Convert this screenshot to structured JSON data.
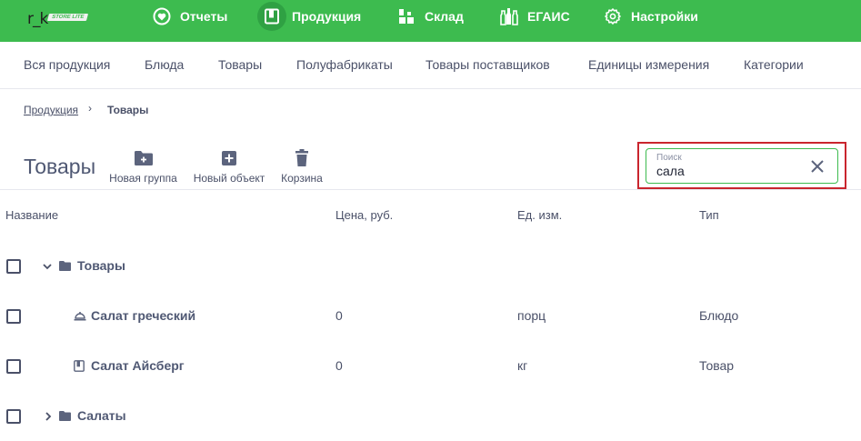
{
  "logo": {
    "text": "r_k",
    "tag": "STORE LITE"
  },
  "topnav": {
    "items": [
      {
        "label": "Отчеты",
        "icon": "heart-circle-icon"
      },
      {
        "label": "Продукция",
        "icon": "book-icon",
        "active": true
      },
      {
        "label": "Склад",
        "icon": "boxes-icon"
      },
      {
        "label": "ЕГАИС",
        "icon": "bottles-icon"
      },
      {
        "label": "Настройки",
        "icon": "gear-icon"
      }
    ]
  },
  "subnav": {
    "items": [
      "Вся продукция",
      "Блюда",
      "Товары",
      "Полуфабрикаты",
      "Товары поставщиков",
      "Единицы измерения",
      "Категории"
    ]
  },
  "breadcrumb": {
    "parent": "Продукция",
    "separator": "›",
    "current": "Товары"
  },
  "page": {
    "title": "Товары"
  },
  "toolbar": {
    "new_group": "Новая группа",
    "new_object": "Новый объект",
    "trash": "Корзина"
  },
  "search": {
    "placeholder": "Поиск",
    "value": "сала"
  },
  "table": {
    "columns": [
      "Название",
      "Цена, руб.",
      "Ед. изм.",
      "Тип"
    ],
    "rows": [
      {
        "kind": "group",
        "expanded": true,
        "name": "Товары"
      },
      {
        "kind": "item",
        "icon": "dish-icon",
        "name": "Салат греческий",
        "price": "0",
        "unit": "порц",
        "type": "Блюдо"
      },
      {
        "kind": "item",
        "icon": "product-icon",
        "name": "Салат Айсберг",
        "price": "0",
        "unit": "кг",
        "type": "Товар"
      },
      {
        "kind": "group",
        "expanded": false,
        "name": "Салаты"
      }
    ]
  },
  "colors": {
    "brand_green": "#3dbb4f",
    "text": "#4a5068",
    "highlight_red": "#c9252e"
  }
}
